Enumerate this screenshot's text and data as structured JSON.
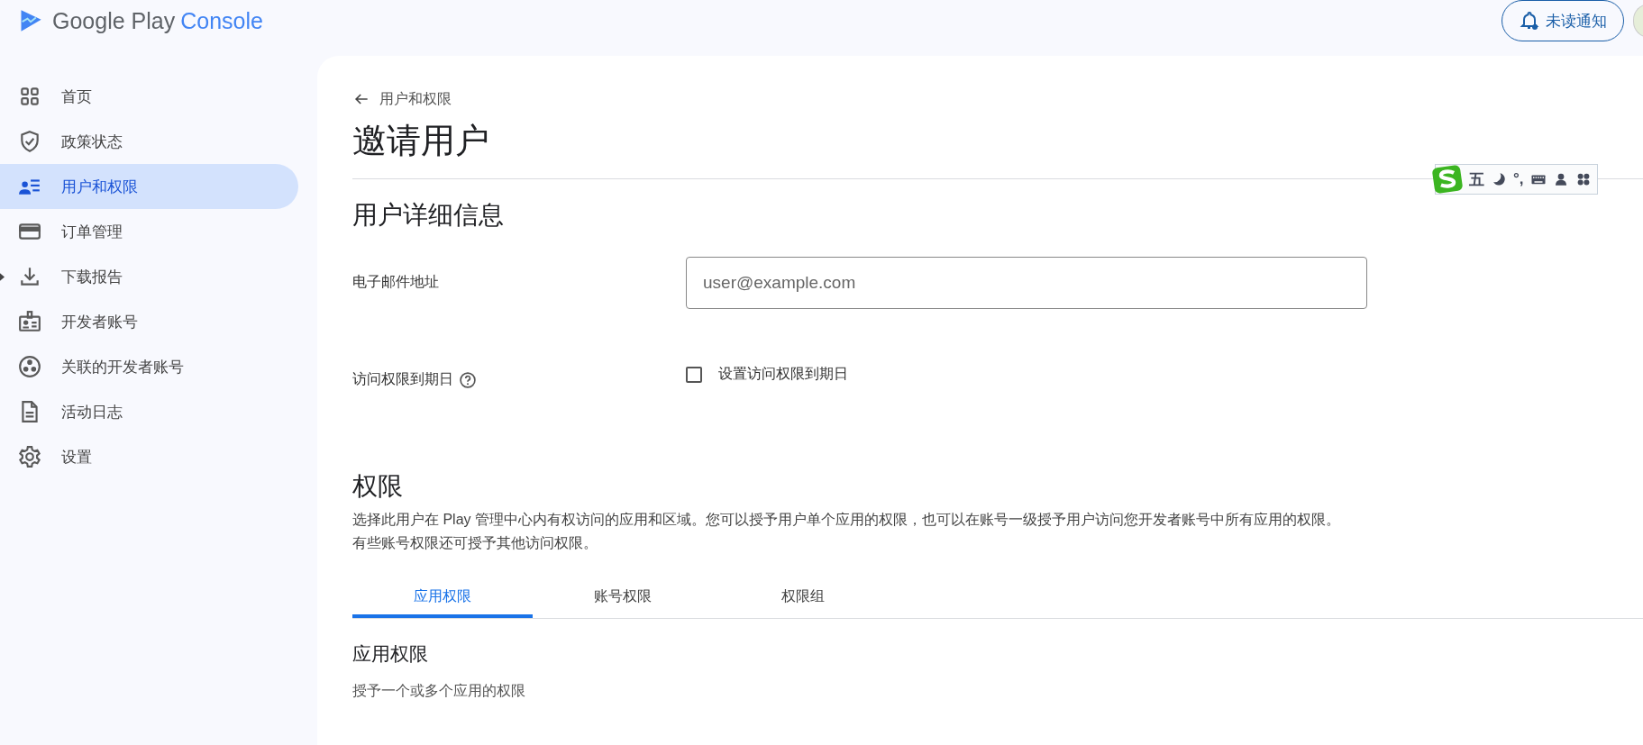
{
  "header": {
    "logo_text": "Google Play",
    "logo_accent": "Console",
    "notification_button": "未读通知"
  },
  "sidebar": {
    "items": [
      {
        "label": "首页",
        "selected": false
      },
      {
        "label": "政策状态",
        "selected": false
      },
      {
        "label": "用户和权限",
        "selected": true
      },
      {
        "label": "订单管理",
        "selected": false
      },
      {
        "label": "下载报告",
        "selected": false
      },
      {
        "label": "开发者账号",
        "selected": false
      },
      {
        "label": "关联的开发者账号",
        "selected": false
      },
      {
        "label": "活动日志",
        "selected": false
      },
      {
        "label": "设置",
        "selected": false
      }
    ]
  },
  "page": {
    "back_link": "用户和权限",
    "title": "邀请用户"
  },
  "user_details": {
    "heading": "用户详细信息",
    "email_label": "电子邮件地址",
    "email_field": {
      "placeholder": "user@example.com"
    },
    "expiry_label": "访问权限到期日",
    "expiry_checkbox": {
      "label": "设置访问权限到期日",
      "checked": false
    }
  },
  "permissions": {
    "heading": "权限",
    "description": "选择此用户在 Play 管理中心内有权访问的应用和区域。您可以授予用户单个应用的权限，也可以在账号一级授予用户访问您开发者账号中所有应用的权限。有些账号权限还可授予其他访问权限。",
    "tabs": [
      {
        "label": "应用权限",
        "selected": true
      },
      {
        "label": "账号权限",
        "selected": false
      },
      {
        "label": "权限组",
        "selected": false
      }
    ],
    "section_heading": "应用权限",
    "section_text": "授予一个或多个应用的权限"
  },
  "ime_toolbar": {
    "mode": "五",
    "punctuation": "°,"
  }
}
